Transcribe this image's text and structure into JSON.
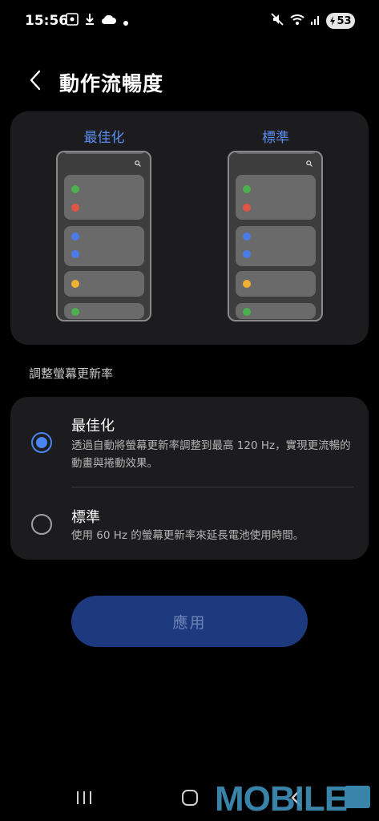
{
  "status_bar": {
    "time": "15:56",
    "battery": "53"
  },
  "header": {
    "title": "動作流暢度"
  },
  "preview": {
    "left_label": "最佳化",
    "right_label": "標準"
  },
  "section_label": "調整螢幕更新率",
  "options": [
    {
      "title": "最佳化",
      "description": "透過自動將螢幕更新率調整到最高 120 Hz，實現更流暢的動畫與捲動效果。",
      "selected": true
    },
    {
      "title": "標準",
      "description": "使用 60 Hz 的螢幕更新率來延長電池使用時間。",
      "selected": false
    }
  ],
  "apply_button": {
    "label": "應用"
  },
  "watermark": "MOBILE",
  "colors": {
    "accent": "#4a84f0",
    "apply_bg": "#1e3a7e",
    "card_bg": "#1c1c1e"
  }
}
